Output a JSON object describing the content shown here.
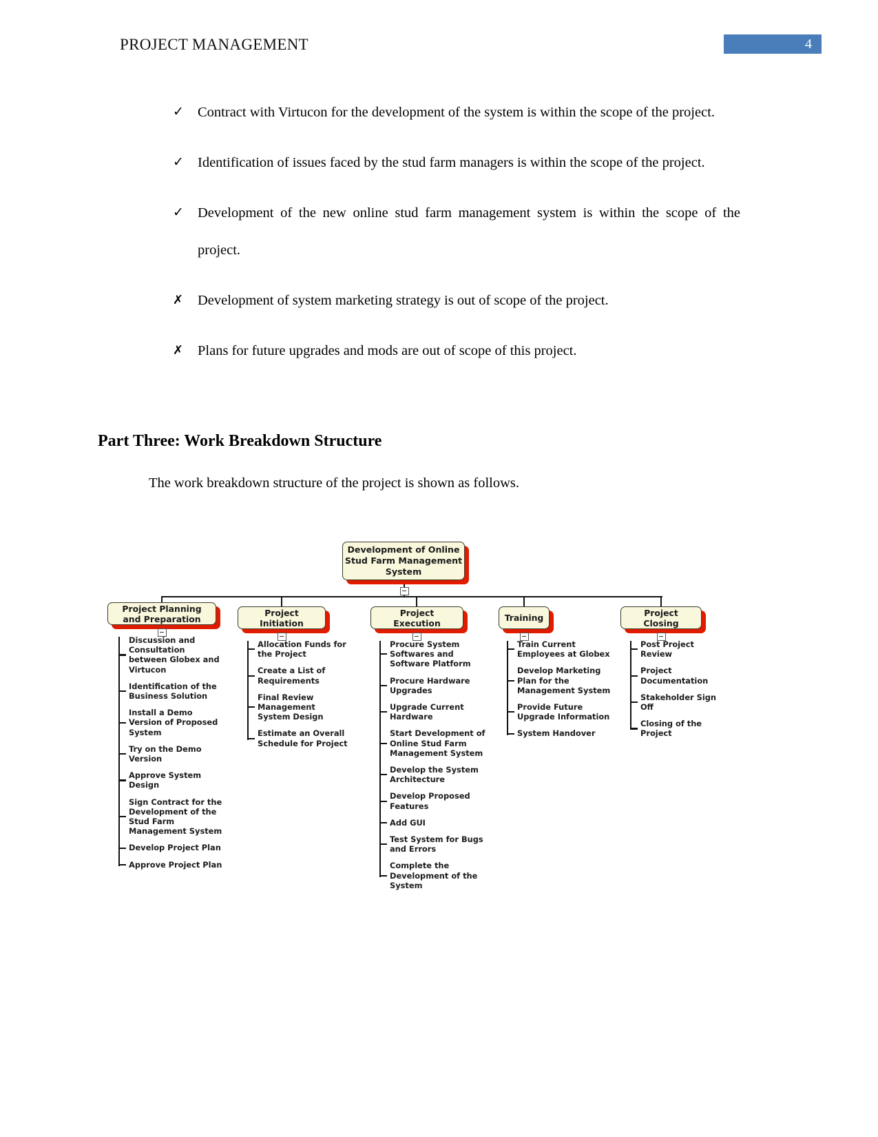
{
  "header": {
    "title": "PROJECT MANAGEMENT",
    "page_number": "4",
    "badge_color": "#4a7ebb"
  },
  "scope_list": [
    {
      "marker": "✓",
      "marker_type": "check",
      "text": "Contract with Virtucon for the development of the system is within the scope of the project."
    },
    {
      "marker": "✓",
      "marker_type": "check",
      "text": "Identification of issues faced by the stud farm managers is within the scope of the project."
    },
    {
      "marker": "✓",
      "marker_type": "check",
      "text": "Development of the new online stud farm management system is within the scope of the project."
    },
    {
      "marker": "✗",
      "marker_type": "cross",
      "text": "Development of system marketing strategy is out of scope of the project."
    },
    {
      "marker": "✗",
      "marker_type": "cross",
      "text": "Plans for future upgrades and mods are out of scope of this project."
    }
  ],
  "section": {
    "heading": "Part Three: Work Breakdown Structure",
    "intro": "The work breakdown structure of the project is shown as follows."
  },
  "wbs": {
    "node_fill": "#f9f8dd",
    "node_shadow": "#e01b00",
    "root": "Development of Online Stud Farm Management System",
    "branches": [
      {
        "label": "Project Planning and Preparation",
        "tasks": [
          "Discussion and Consultation between Globex and Virtucon",
          "Identification of the Business Solution",
          "Install a Demo Version of Proposed System",
          "Try on the Demo Version",
          "Approve System Design",
          "Sign Contract for the Development of the Stud Farm Management System",
          "Develop Project Plan",
          "Approve Project Plan"
        ]
      },
      {
        "label": "Project Initiation",
        "tasks": [
          "Allocation Funds for the Project",
          "Create a List of Requirements",
          "Final Review Management System Design",
          "Estimate an Overall Schedule for Project"
        ]
      },
      {
        "label": "Project Execution",
        "tasks": [
          "Procure System Softwares and Software Platform",
          "Procure Hardware Upgrades",
          "Upgrade Current Hardware",
          "Start Development of Online Stud Farm Management System",
          "Develop the System Architecture",
          "Develop Proposed Features",
          "Add GUI",
          "Test System for Bugs and Errors",
          "Complete the Development of the System"
        ]
      },
      {
        "label": "Training",
        "tasks": [
          "Train Current Employees at Globex",
          "Develop Marketing Plan for the Management System",
          "Provide Future Upgrade Information",
          "System Handover"
        ]
      },
      {
        "label": "Project Closing",
        "tasks": [
          "Post Project Review",
          "Project Documentation",
          "Stakeholder Sign Off",
          "Closing of the Project"
        ]
      }
    ]
  }
}
